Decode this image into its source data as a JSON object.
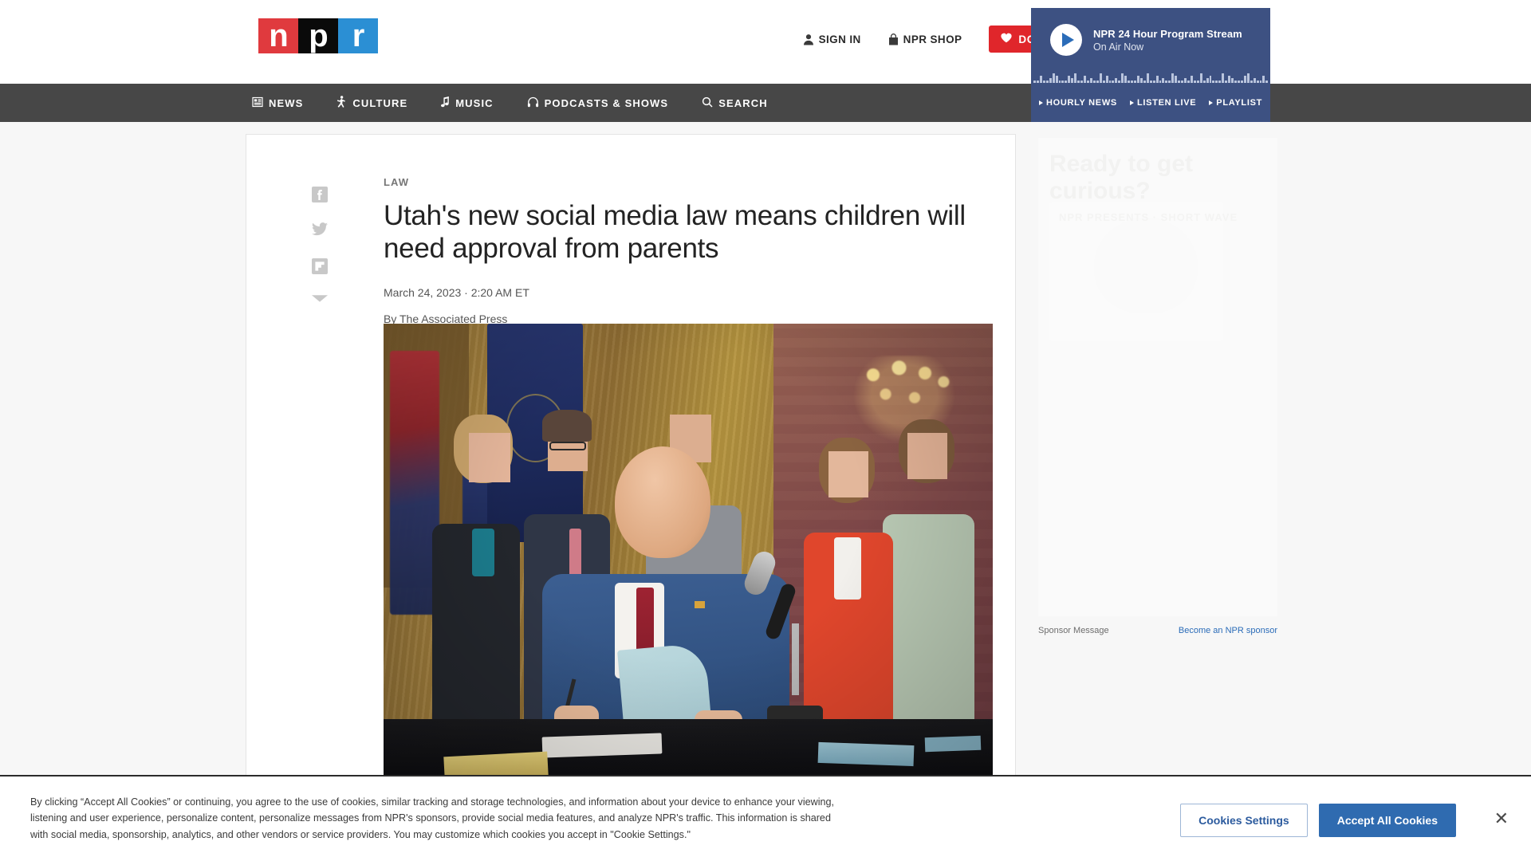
{
  "header": {
    "logo_letters": [
      "n",
      "p",
      "r"
    ],
    "links": [
      {
        "label": "SIGN IN",
        "icon": "user-icon"
      },
      {
        "label": "NPR SHOP",
        "icon": "shopping-bag-icon"
      }
    ],
    "donate_label": "DONATE",
    "donate_color": "#e0262b"
  },
  "player": {
    "title": "NPR 24 Hour Program Stream",
    "subtitle": "On Air Now",
    "play_icon": "play-icon",
    "background": "#3d5182"
  },
  "nav": {
    "items": [
      {
        "label": "NEWS",
        "icon": "news-grid-icon"
      },
      {
        "label": "CULTURE",
        "icon": "person-dancing-icon"
      },
      {
        "label": "MUSIC",
        "icon": "music-note-icon"
      },
      {
        "label": "PODCASTS & SHOWS",
        "icon": "headphones-icon"
      },
      {
        "label": "SEARCH",
        "icon": "search-icon"
      }
    ],
    "right_items": [
      {
        "label": "HOURLY NEWS"
      },
      {
        "label": "LISTEN LIVE"
      },
      {
        "label": "PLAYLIST"
      }
    ]
  },
  "share": [
    {
      "name": "facebook-icon"
    },
    {
      "name": "twitter-icon"
    },
    {
      "name": "flipboard-icon"
    },
    {
      "name": "email-icon"
    }
  ],
  "article": {
    "kicker": "LAW",
    "headline": "Utah's new social media law means children will need approval from parents",
    "date": "March 24, 2023 · 2:20 AM ET",
    "byline": "By The Associated Press"
  },
  "sponsor": {
    "message_label": "Sponsor Message",
    "link_label": "Become an NPR sponsor",
    "ad_headline": "Ready to get curious?",
    "ad_sub": "NPR PRESENTS · SHORT WAVE"
  },
  "cookie": {
    "text": "By clicking “Accept All Cookies” or continuing, you agree to the use of cookies, similar tracking and storage technologies, and information about your device to enhance your viewing, listening and user experience, personalize content, personalize messages from NPR's sponsors, provide social media features, and analyze NPR's traffic. This information is shared with social media, sponsorship, analytics, and other vendors or service providers. You may customize which cookies you accept in \"Cookie Settings.\"",
    "settings_label": "Cookies Settings",
    "accept_label": "Accept All Cookies",
    "close_label": "✕"
  }
}
